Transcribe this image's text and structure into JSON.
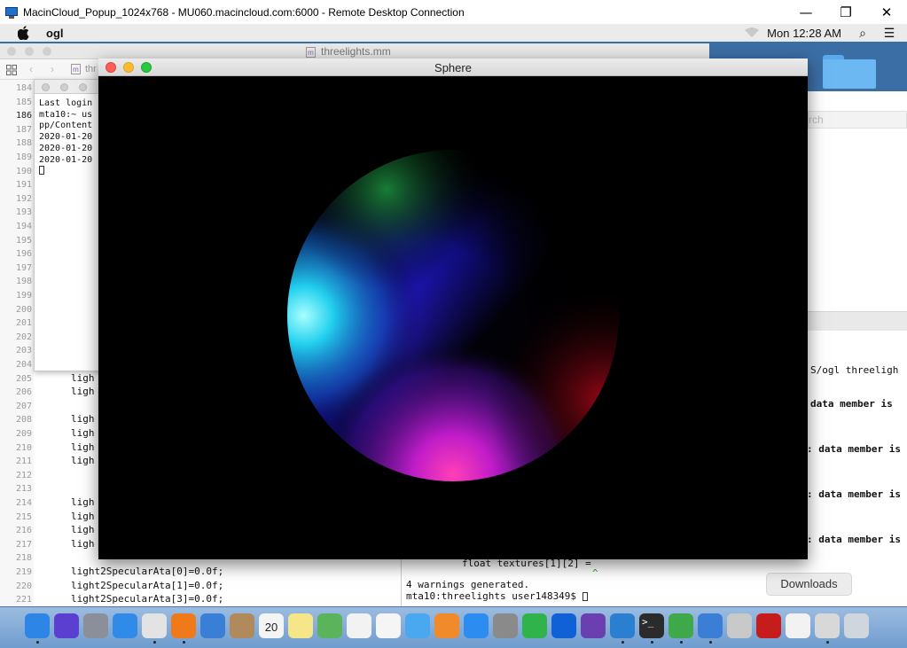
{
  "rdp": {
    "title": "MacinCloud_Popup_1024x768 - MU060.macincloud.com:6000 - Remote Desktop Connection",
    "minimize": "—",
    "restore": "❐",
    "close": "✕"
  },
  "menubar": {
    "apple": "",
    "app_name": "ogl",
    "clock": "Mon 12:28 AM",
    "search_glyph": "⌕",
    "list_glyph": "☰"
  },
  "xcode": {
    "filename": "threelights.mm",
    "file_glyph": "m",
    "tab_label": "thr",
    "line_numbers": [
      "184",
      "185",
      "186",
      "187",
      "188",
      "189",
      "190",
      "191",
      "192",
      "193",
      "194",
      "195",
      "196",
      "197",
      "198",
      "199",
      "200",
      "201",
      "202",
      "203",
      "204",
      "205",
      "206",
      "207",
      "208",
      "209",
      "210",
      "211",
      "212",
      "213",
      "214",
      "215",
      "216",
      "217",
      "218",
      "219",
      "220",
      "221"
    ],
    "active_line": "186",
    "code_lines": [
      {
        "line": "205",
        "text": "ligh"
      },
      {
        "line": "206",
        "text": "ligh"
      },
      {
        "line": "208",
        "text": "ligh"
      },
      {
        "line": "209",
        "text": "ligh"
      },
      {
        "line": "210",
        "text": "ligh"
      },
      {
        "line": "211",
        "text": "ligh"
      },
      {
        "line": "214",
        "text": "ligh"
      },
      {
        "line": "215",
        "text": "ligh"
      },
      {
        "line": "216",
        "text": "ligh"
      },
      {
        "line": "217",
        "text": "ligh"
      },
      {
        "line": "219",
        "text": "light2SpecularAta[0]=0.0f;"
      },
      {
        "line": "220",
        "text": "light2SpecularAta[1]=0.0f;"
      },
      {
        "line": "221",
        "text": "light2SpecularAta[3]=0.0f;"
      }
    ]
  },
  "terminal": {
    "lines": [
      "Last login",
      "mta10:~ us",
      "pp/Content",
      "2020-01-20",
      "2020-01-20",
      "2020-01-20"
    ]
  },
  "finder": {
    "search_placeholder": "rch"
  },
  "build_log": {
    "cmd_fragment": "S/ogl threeligh",
    "warn1": "data member is",
    "warn2": ": data member is",
    "warn3": ": data member is",
    "warn4": ": data member is",
    "code_fragment": "float textures[1][2] =",
    "caret": "^",
    "summary": "4 warnings generated.",
    "prompt": "mta10:threelights user148349$"
  },
  "downloads_label": "Downloads",
  "sphere_window": {
    "title": "Sphere"
  },
  "dock": {
    "icons": [
      "finder-icon",
      "siri-icon",
      "launchpad-icon",
      "safari-icon",
      "chrome-icon",
      "firefox-icon",
      "preview-icon",
      "contacts-icon",
      "calendar-icon",
      "notes-icon",
      "maps-icon",
      "reminders-icon",
      "photos-icon",
      "messages-icon",
      "books-icon",
      "app-store-icon",
      "system-preferences-icon",
      "evernote-icon",
      "dropbox-icon",
      "visual-studio-icon",
      "vscode-icon",
      "terminal-icon",
      "android-studio-icon",
      "xcode-icon",
      "instruments-icon",
      "acrobat-icon",
      "document-icon",
      "remote-desktop-icon",
      "trash-icon"
    ],
    "calendar_day": "20"
  }
}
